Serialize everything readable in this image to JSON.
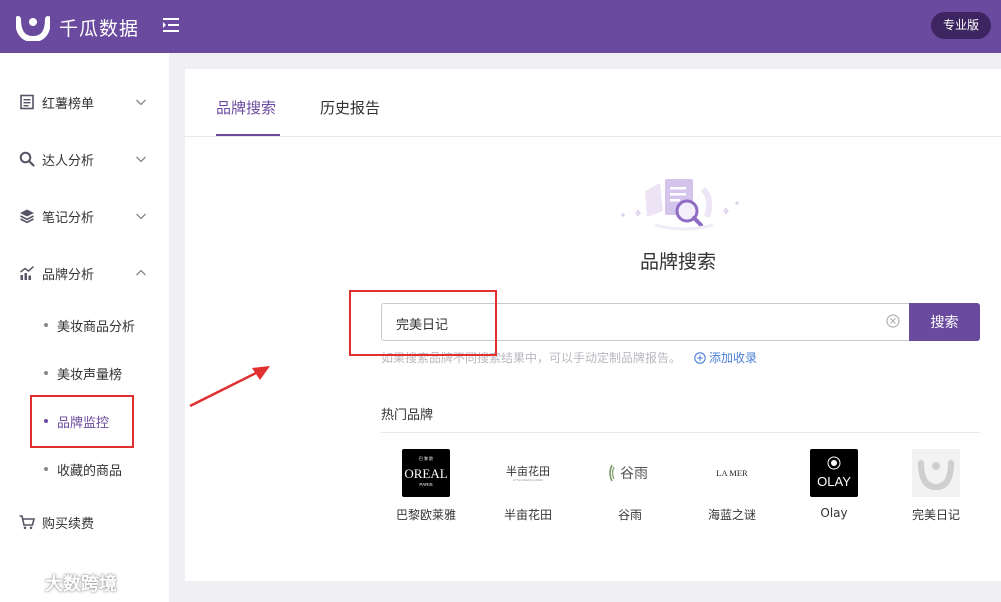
{
  "header": {
    "app_title": "千瓜数据",
    "pro_label": "专业版",
    "brand_color": "#6a4a9e"
  },
  "sidebar": {
    "items": [
      {
        "label": "红薯榜单",
        "icon": "list-icon",
        "expanded": false
      },
      {
        "label": "达人分析",
        "icon": "search-icon",
        "expanded": false
      },
      {
        "label": "笔记分析",
        "icon": "layers-icon",
        "expanded": false
      },
      {
        "label": "品牌分析",
        "icon": "chart-icon",
        "expanded": true
      },
      {
        "label": "购买续费",
        "icon": "cart-icon",
        "expanded": false
      }
    ],
    "sub_items": [
      {
        "label": "美妆商品分析",
        "active": false
      },
      {
        "label": "美妆声量榜",
        "active": false
      },
      {
        "label": "品牌监控",
        "active": true
      },
      {
        "label": "收藏的商品",
        "active": false
      }
    ]
  },
  "main": {
    "tabs": [
      {
        "label": "品牌搜索",
        "active": true
      },
      {
        "label": "历史报告",
        "active": false
      }
    ],
    "search_title": "品牌搜索",
    "search": {
      "value": "完美日记",
      "button_label": "搜索"
    },
    "hint": "如果搜索品牌不同搜索结果中，可以手动定制品牌报告。",
    "add_collect_label": "添加收录",
    "hot_title": "热门品牌",
    "hot_brands": [
      {
        "name": "巴黎欧莱雅",
        "logo_text": "OREAL",
        "icon": "loreal-logo-icon"
      },
      {
        "name": "半亩花田",
        "logo_text": "半亩花田",
        "icon": "banmu-logo-icon"
      },
      {
        "name": "谷雨",
        "logo_text": "谷雨",
        "icon": "guyu-logo-icon"
      },
      {
        "name": "海蓝之谜",
        "logo_text": "LA MER",
        "icon": "lamer-logo-icon"
      },
      {
        "name": "Olay",
        "logo_text": "OLAY",
        "icon": "olay-logo-icon"
      },
      {
        "name": "完美日记",
        "logo_text": "",
        "icon": "perfect-diary-logo-icon"
      }
    ]
  },
  "watermark": {
    "text": "大数跨境"
  },
  "colors": {
    "accent": "#6a4a9e",
    "annotation": "#e03030",
    "link": "#4a7fd4"
  }
}
